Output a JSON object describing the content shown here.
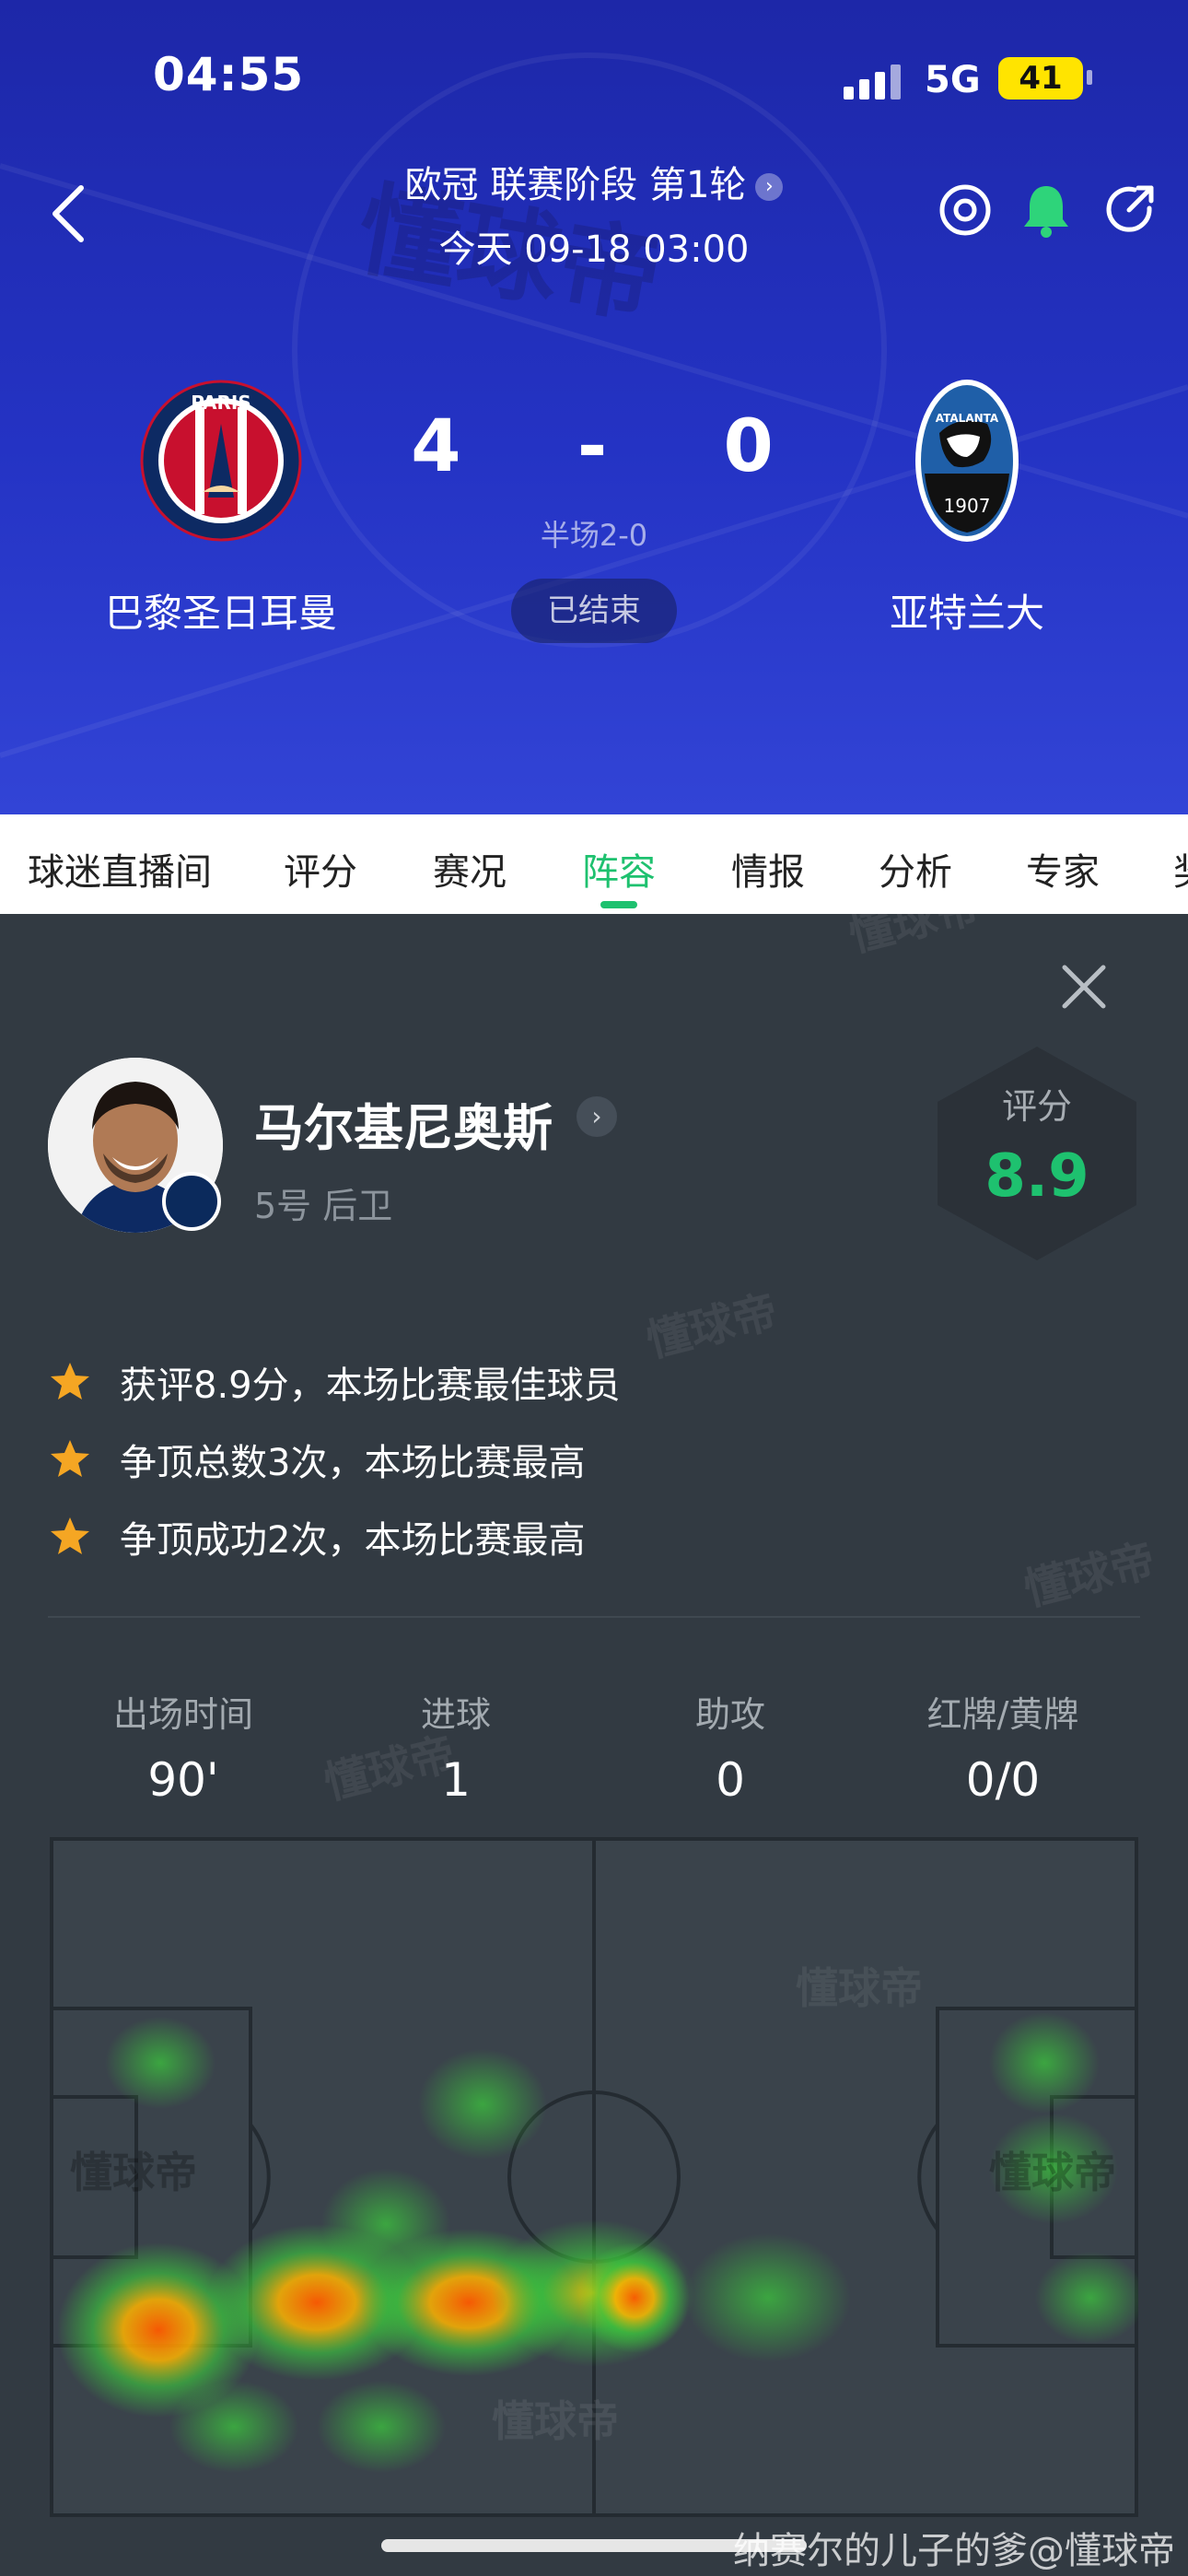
{
  "status_bar": {
    "time": "04:55",
    "network": "5G",
    "battery": "41"
  },
  "match": {
    "competition": "欧冠 联赛阶段 第1轮",
    "datetime": "今天 09-18 03:00",
    "home_team": "巴黎圣日耳曼",
    "away_team": "亚特兰大",
    "home_score": "4",
    "score_separator": "-",
    "away_score": "0",
    "halftime": "半场2-0",
    "status": "已结束",
    "home_logo_text": "PARIS",
    "away_logo_text": "ATALANTA",
    "away_logo_year": "1907"
  },
  "icons": {
    "back": "chevron-left-icon",
    "watch": "target-icon",
    "notify": "bell-icon",
    "share": "share-icon",
    "close": "close-icon",
    "star": "star-icon"
  },
  "tabs": [
    "球迷直播间",
    "评分",
    "赛况",
    "阵容",
    "情报",
    "分析",
    "专家",
    "奖"
  ],
  "active_tab": "阵容",
  "player": {
    "name": "马尔基尼奥斯",
    "number_position": "5号 后卫",
    "rating_label": "评分",
    "rating": "8.9",
    "highlights": [
      "获评8.9分，本场比赛最佳球员",
      "争顶总数3次，本场比赛最高",
      "争顶成功2次，本场比赛最高"
    ],
    "stats": [
      {
        "label": "出场时间",
        "value": "90'"
      },
      {
        "label": "进球",
        "value": "1"
      },
      {
        "label": "助攻",
        "value": "0"
      },
      {
        "label": "红牌/黄牌",
        "value": "0/0"
      }
    ]
  },
  "watermark": "懂球帝",
  "credit": "纳赛尔的儿子的爹@懂球帝",
  "colors": {
    "accent_green": "#1ec16f",
    "header_blue": "#2433c4",
    "panel_bg": "#323a42",
    "star": "#f5a623"
  }
}
